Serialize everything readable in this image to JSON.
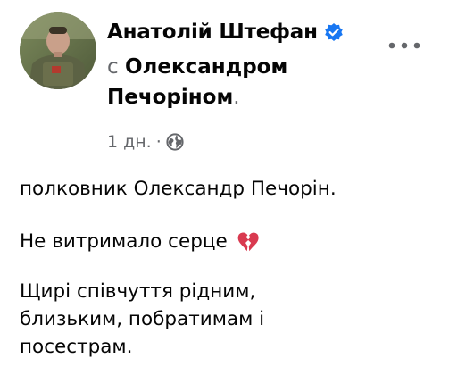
{
  "post": {
    "author": "Анатолій Штефан",
    "with_word": "с",
    "tagged_line1": "Олександром",
    "tagged_line2": "Печоріном",
    "trailing_dot": ".",
    "time": "1 дн.",
    "time_separator": "·",
    "paragraphs": {
      "p1": "полковник Олександр Печорін.",
      "p2": "Не витримало серце",
      "p3_line1": "Щирі співчуття рідним,",
      "p3_line2": "близьким, побратимам і",
      "p3_line3": "посестрам."
    }
  },
  "icons": {
    "verified": "verified-badge-icon",
    "audience": "globe-icon",
    "more": "more-options-icon",
    "emoji": "broken-heart-icon"
  },
  "colors": {
    "text": "#050505",
    "secondary": "#65676b",
    "verified": "#1877f2",
    "heart": "#e0245e"
  }
}
